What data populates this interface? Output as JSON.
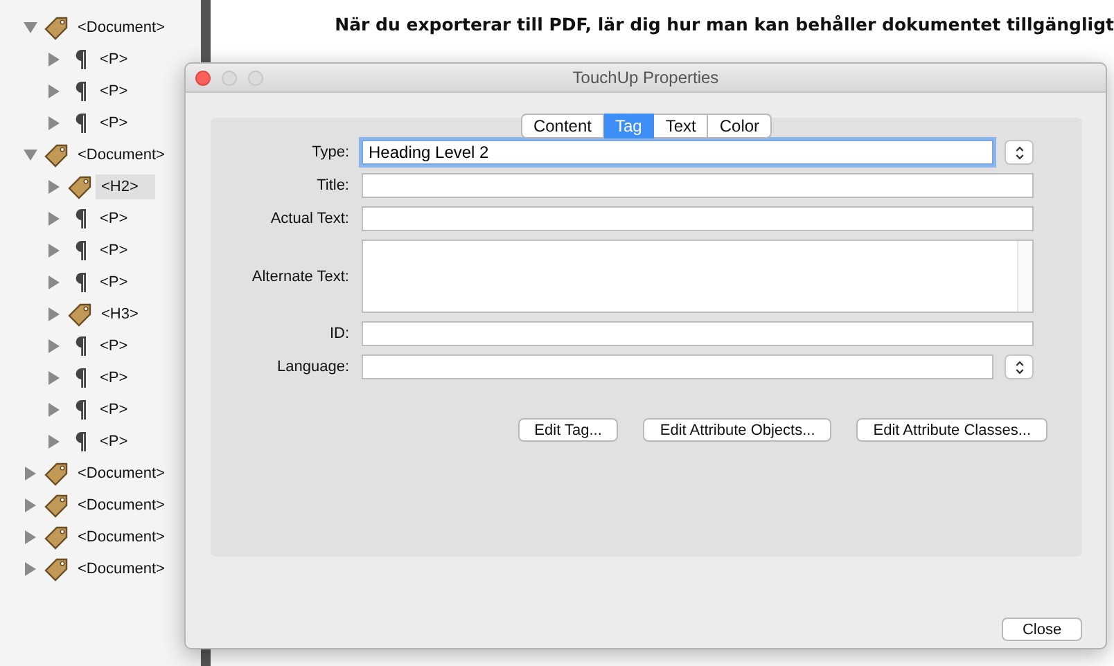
{
  "tag_tree": [
    {
      "label": "<Document>",
      "kind": "tag",
      "expanded": true,
      "selected": false,
      "children": [
        {
          "label": "<P>",
          "kind": "paragraph",
          "expanded": false,
          "selected": false
        },
        {
          "label": "<P>",
          "kind": "paragraph",
          "expanded": false,
          "selected": false
        },
        {
          "label": "<P>",
          "kind": "paragraph",
          "expanded": false,
          "selected": false
        }
      ]
    },
    {
      "label": "<Document>",
      "kind": "tag",
      "expanded": true,
      "selected": false,
      "children": [
        {
          "label": "<H2>",
          "kind": "tag",
          "expanded": false,
          "selected": true
        },
        {
          "label": "<P>",
          "kind": "paragraph",
          "expanded": false,
          "selected": false
        },
        {
          "label": "<P>",
          "kind": "paragraph",
          "expanded": false,
          "selected": false
        },
        {
          "label": "<P>",
          "kind": "paragraph",
          "expanded": false,
          "selected": false
        },
        {
          "label": "<H3>",
          "kind": "tag",
          "expanded": false,
          "selected": false
        },
        {
          "label": "<P>",
          "kind": "paragraph",
          "expanded": false,
          "selected": false
        },
        {
          "label": "<P>",
          "kind": "paragraph",
          "expanded": false,
          "selected": false
        },
        {
          "label": "<P>",
          "kind": "paragraph",
          "expanded": false,
          "selected": false
        },
        {
          "label": "<P>",
          "kind": "paragraph",
          "expanded": false,
          "selected": false
        }
      ]
    },
    {
      "label": "<Document>",
      "kind": "tag",
      "expanded": false,
      "selected": false
    },
    {
      "label": "<Document>",
      "kind": "tag",
      "expanded": false,
      "selected": false
    },
    {
      "label": "<Document>",
      "kind": "tag",
      "expanded": false,
      "selected": false
    },
    {
      "label": "<Document>",
      "kind": "tag",
      "expanded": false,
      "selected": false
    }
  ],
  "document": {
    "heading": "När du exporterar till PDF, lär dig hur man kan behåller dokumentet tillgängligt"
  },
  "dialog": {
    "title": "TouchUp Properties",
    "tabs": [
      {
        "label": "Content",
        "selected": false
      },
      {
        "label": "Tag",
        "selected": true
      },
      {
        "label": "Text",
        "selected": false
      },
      {
        "label": "Color",
        "selected": false
      }
    ],
    "fields": [
      {
        "label": "Type:",
        "kind": "select",
        "value": "Heading Level 2",
        "focused": true
      },
      {
        "label": "Title:",
        "kind": "text",
        "focused": false
      },
      {
        "label": "Actual Text:",
        "kind": "text",
        "focused": false
      },
      {
        "label": "Alternate Text:",
        "kind": "textarea",
        "focused": false
      },
      {
        "label": "ID:",
        "kind": "text",
        "focused": false
      },
      {
        "label": "Language:",
        "kind": "select",
        "focused": false
      }
    ],
    "buttons": [
      "Edit Tag...",
      "Edit Attribute Objects...",
      "Edit Attribute Classes..."
    ],
    "close_button": "Close"
  }
}
